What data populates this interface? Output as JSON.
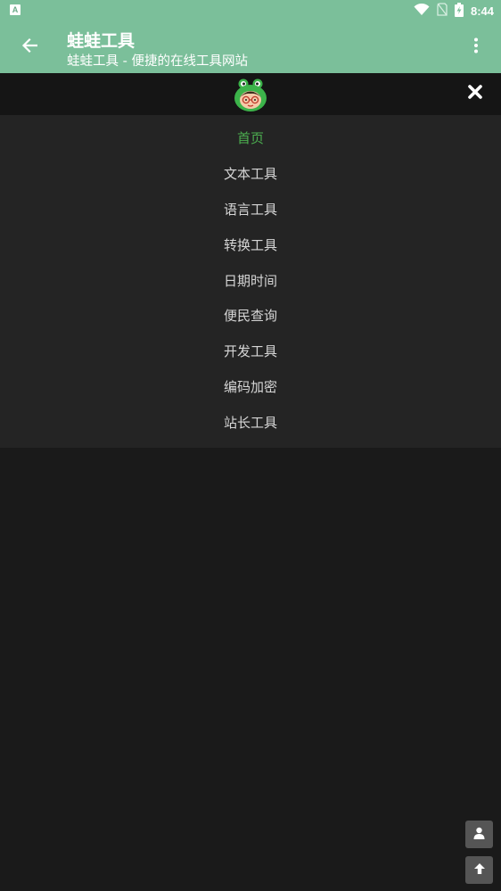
{
  "status_bar": {
    "app_icon_letter": "A",
    "time": "8:44",
    "icons": [
      "wifi-icon",
      "no-sim-icon",
      "battery-charging-icon"
    ]
  },
  "app_bar": {
    "title": "蛙蛙工具",
    "subtitle": "蛙蛙工具 - 便捷的在线工具网站",
    "back_icon": "arrow-left-icon",
    "menu_icon": "more-vertical-icon"
  },
  "logo_row": {
    "logo_icon": "frog-logo-icon",
    "close_icon": "close-icon"
  },
  "nav": {
    "items": [
      {
        "label": "首页",
        "active": true
      },
      {
        "label": "文本工具",
        "active": false
      },
      {
        "label": "语言工具",
        "active": false
      },
      {
        "label": "转换工具",
        "active": false
      },
      {
        "label": "日期时间",
        "active": false
      },
      {
        "label": "便民查询",
        "active": false
      },
      {
        "label": "开发工具",
        "active": false
      },
      {
        "label": "编码加密",
        "active": false
      },
      {
        "label": "站长工具",
        "active": false
      }
    ]
  },
  "floating": {
    "user_icon": "user-icon",
    "top_icon": "arrow-up-icon"
  },
  "colors": {
    "header": "#7bbf9a",
    "active": "#4caf50",
    "background": "#1a1a1a",
    "menu_bg": "#242424"
  }
}
